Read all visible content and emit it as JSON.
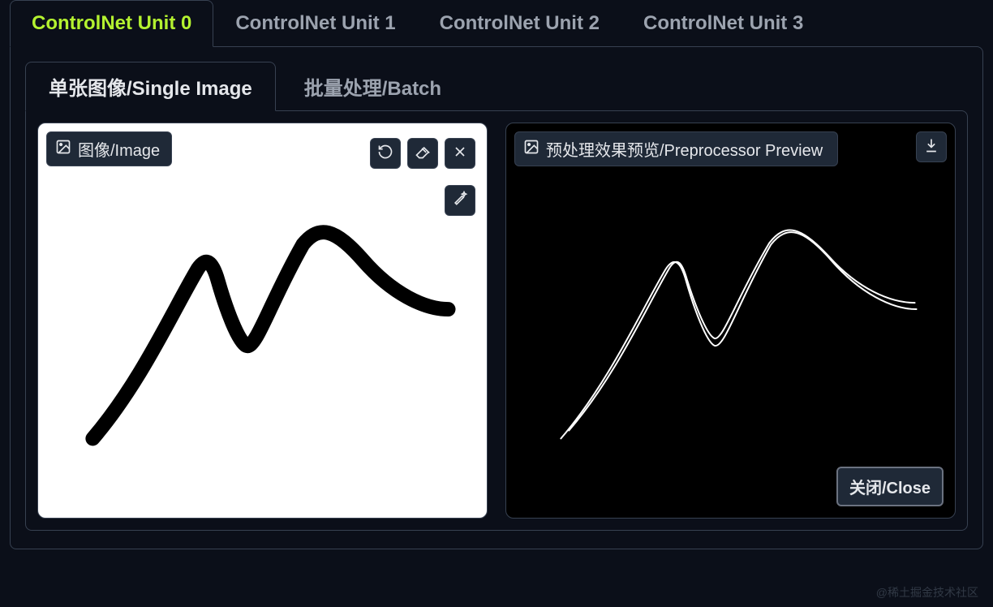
{
  "outer_tabs": {
    "items": [
      {
        "label": "ControlNet Unit 0",
        "active": true
      },
      {
        "label": "ControlNet Unit 1",
        "active": false
      },
      {
        "label": "ControlNet Unit 2",
        "active": false
      },
      {
        "label": "ControlNet Unit 3",
        "active": false
      }
    ]
  },
  "inner_tabs": {
    "items": [
      {
        "label": "单张图像/Single Image",
        "active": true
      },
      {
        "label": "批量处理/Batch",
        "active": false
      }
    ]
  },
  "left_panel": {
    "label": "图像/Image"
  },
  "right_panel": {
    "label": "预处理效果预览/Preprocessor Preview",
    "close_label": "关闭/Close"
  },
  "watermark": "@稀土掘金技术社区"
}
